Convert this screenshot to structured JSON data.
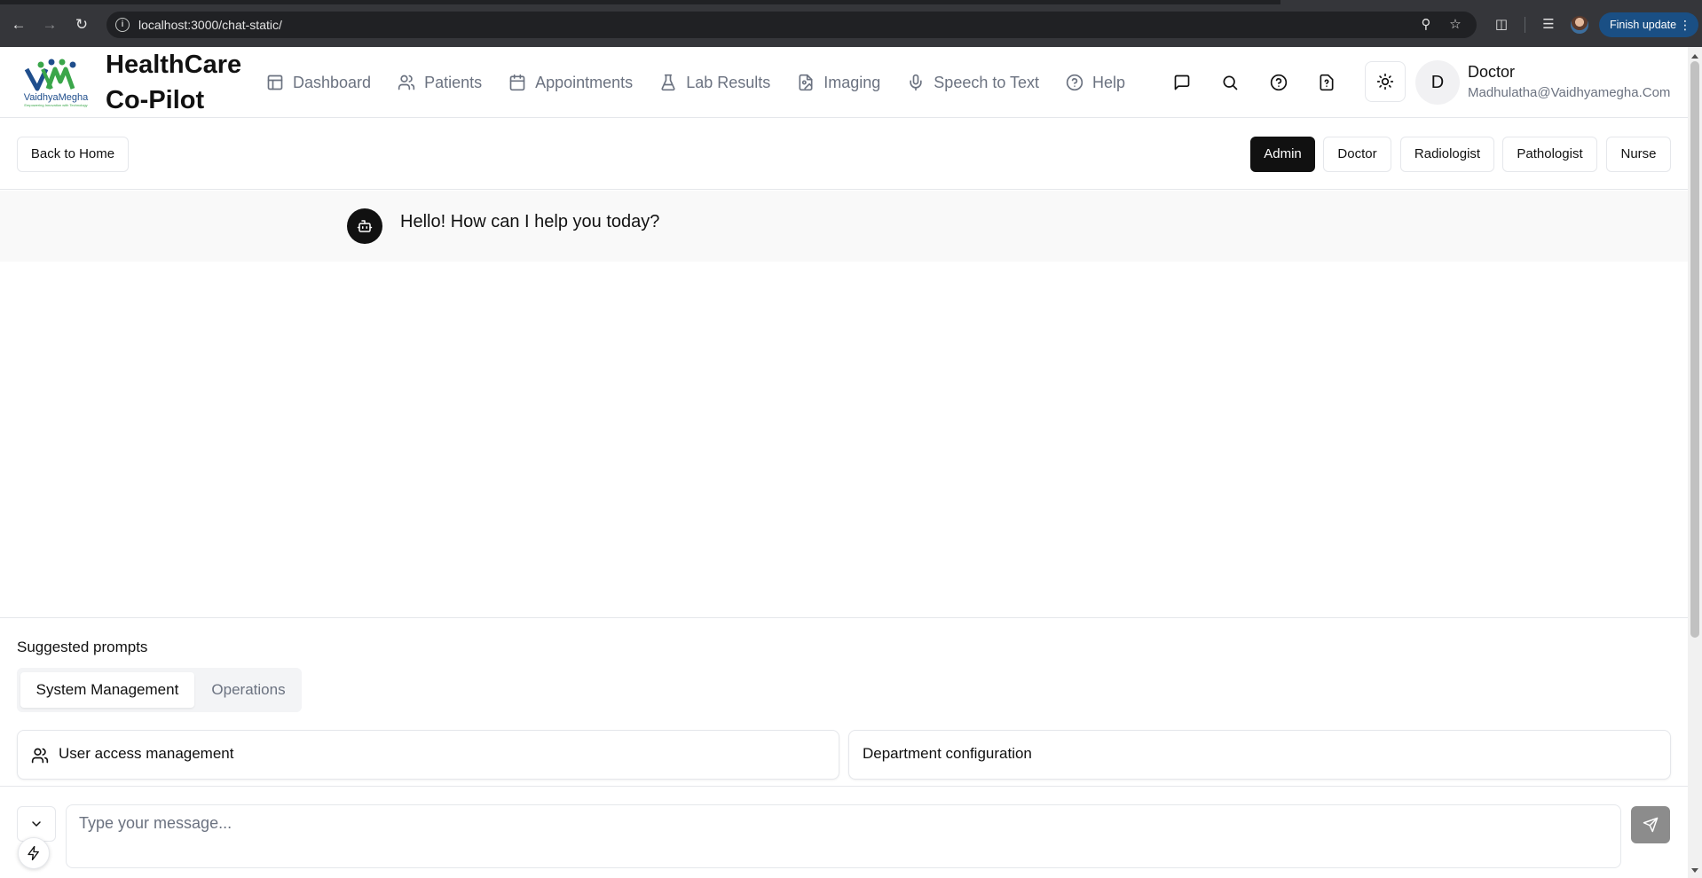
{
  "browser": {
    "url": "localhost:3000/chat-static/",
    "update_button": "Finish update"
  },
  "header": {
    "logo_text": "VaidhyaMegha",
    "logo_tagline": "Empowering Innovation with Technology",
    "brand_line1": "HealthCare",
    "brand_line2": "Co-Pilot",
    "nav": [
      {
        "label": "Dashboard",
        "icon": "layout-icon"
      },
      {
        "label": "Patients",
        "icon": "users-icon"
      },
      {
        "label": "Appointments",
        "icon": "calendar-icon"
      },
      {
        "label": "Lab Results",
        "icon": "flask-icon"
      },
      {
        "label": "Imaging",
        "icon": "image-file-icon"
      },
      {
        "label": "Speech to Text",
        "icon": "mic-icon"
      },
      {
        "label": "Help",
        "icon": "help-circle-icon"
      }
    ],
    "user": {
      "initial": "D",
      "name": "Doctor",
      "email": "Madhulatha@Vaidhyamegha.Com"
    }
  },
  "rolebar": {
    "back_label": "Back to Home",
    "roles": [
      "Admin",
      "Doctor",
      "Radiologist",
      "Pathologist",
      "Nurse"
    ],
    "active_role": "Admin"
  },
  "chat": {
    "bot_message": "Hello! How can I help you today?"
  },
  "prompts": {
    "title": "Suggested prompts",
    "tabs": [
      "System Management",
      "Operations"
    ],
    "active_tab": "System Management",
    "cards": [
      "User access management",
      "Department configuration"
    ]
  },
  "input": {
    "placeholder": "Type your message..."
  },
  "colors": {
    "primary": "#111111",
    "muted_text": "#6b7280",
    "border": "#e5e7eb",
    "send_button": "#8c8c8c",
    "logo_blue": "#1f4e8c",
    "logo_green": "#3aa64a"
  }
}
